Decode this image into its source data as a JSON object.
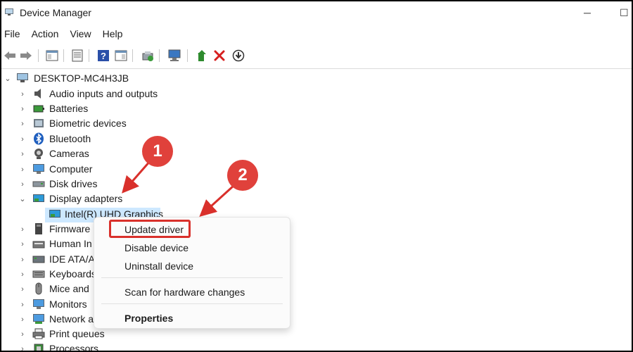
{
  "window": {
    "title": "Device Manager"
  },
  "menubar": {
    "items": [
      "File",
      "Action",
      "View",
      "Help"
    ]
  },
  "toolbar": {
    "buttons": [
      "back-icon",
      "forward-icon",
      "show-hide-console-tree-icon",
      "properties-icon",
      "help-icon",
      "action-pane-icon",
      "update-driver-icon",
      "scan-hardware-icon",
      "enable-device-icon",
      "uninstall-device-icon",
      "download-driver-icon"
    ]
  },
  "tree": {
    "root": "DESKTOP-MC4H3JB",
    "categories": [
      "Audio inputs and outputs",
      "Batteries",
      "Biometric devices",
      "Bluetooth",
      "Cameras",
      "Computer",
      "Disk drives",
      "Display adapters",
      "Firmware",
      "Human In",
      "IDE ATA/AT",
      "Keyboards",
      "Mice and",
      "Monitors",
      "Network a",
      "Print queues",
      "Processors"
    ],
    "expanded_child": "Intel(R) UHD Graphics"
  },
  "context_menu": {
    "update_driver": "Update driver",
    "disable_device": "Disable device",
    "uninstall_device": "Uninstall device",
    "scan_hardware": "Scan for hardware changes",
    "properties": "Properties"
  },
  "callouts": {
    "step1": "1",
    "step2": "2"
  },
  "colors": {
    "callout": "#e0413b",
    "selection": "#cde8ff",
    "highlight_border": "#d9302b"
  }
}
